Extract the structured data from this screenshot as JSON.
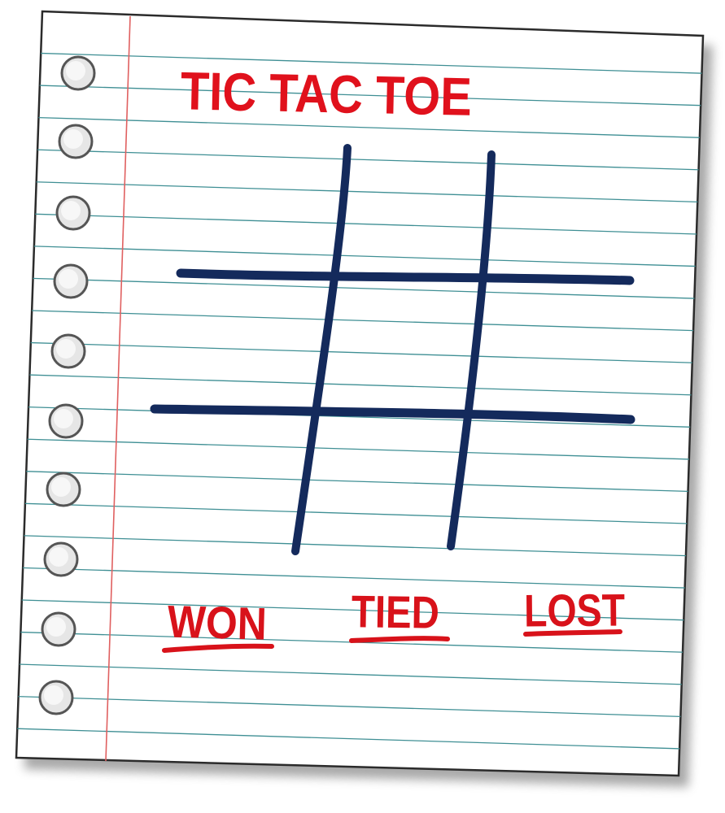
{
  "title": "TIC TAC TOE",
  "score_labels": {
    "won": "WON",
    "tied": "TIED",
    "lost": "LOST"
  },
  "board": {
    "rows": 3,
    "cols": 3,
    "cells": [
      "",
      "",
      "",
      "",
      "",
      "",
      "",
      "",
      ""
    ]
  },
  "colors": {
    "paper": "#ffffff",
    "paper_border": "#2b2b2b",
    "rule_lines": "#3f8f94",
    "margin_line": "#e06060",
    "grid_ink": "#142a5c",
    "title_ink": "#e0111c",
    "label_ink": "#d8121a",
    "hole_fill": "#e6e6e6",
    "hole_border": "#555555",
    "shadow": "#9a9a9a"
  },
  "icons": {
    "binder_holes": "binder-hole-icon",
    "grid": "tic-tac-toe-grid-icon"
  }
}
